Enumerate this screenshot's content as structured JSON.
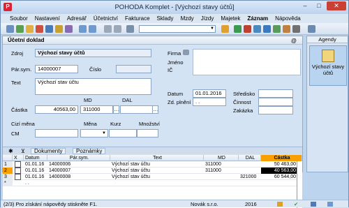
{
  "window": {
    "title": "POHODA Komplet - [Výchozí stavy účtů]",
    "app_letter": "P",
    "minimize": "–",
    "maximize": "□",
    "close": "✕"
  },
  "menu": [
    "Soubor",
    "Nastavení",
    "Adresář",
    "Účetnictví",
    "Fakturace",
    "Sklady",
    "Mzdy",
    "Jízdy",
    "Majetek",
    "Záznam",
    "Nápověda"
  ],
  "panel": {
    "title": "Účetní doklad",
    "at_symbol": "@"
  },
  "form": {
    "zdroj_label": "Zdroj",
    "zdroj_value": "Výchozí stavy účtů",
    "parsym_label": "Pár.sym.",
    "parsym_value": "14000007",
    "cislo_label": "Číslo",
    "cislo_value": "",
    "text_label": "Text",
    "text_value": "Výchozí stav účtu",
    "md_label": "MD",
    "dal_label": "DAL",
    "castka_label": "Částka",
    "castka_value": "40563,00",
    "md_value": "311000",
    "dal_value": "",
    "cizi_mena_label": "Cizí měna",
    "cm_label": "CM",
    "mena_label": "Měna",
    "kurz_label": "Kurz",
    "mnozstvi_label": "Množství",
    "firma_label": "Firma",
    "jmeno_label": "Jméno",
    "ic_label": "IČ",
    "datum_label": "Datum",
    "datum_value": "01.01.2016",
    "zd_plneni_label": "Zd. plnění",
    "zd_plneni_value": ". .",
    "stredisko_label": "Středisko",
    "cinnost_label": "Činnost",
    "zakazka_label": "Zakázka"
  },
  "tabs": {
    "dokumenty": "Dokumenty",
    "poznamky": "Poznámky"
  },
  "grid": {
    "headers": [
      "X",
      "Datum",
      "Pár.sym.",
      "Text",
      "MD",
      "DAL",
      "Částka"
    ],
    "rows": [
      {
        "num": "1",
        "datum": "01.01.16",
        "parsym": "14000006",
        "text": "Výchozí stav účtu",
        "md": "311000",
        "dal": "",
        "castka": "50 463,00"
      },
      {
        "num": "2",
        "datum": "01.01.16",
        "parsym": "14000007",
        "text": "Výchozí stav účtu",
        "md": "311000",
        "dal": "",
        "castka": "40 563,00"
      },
      {
        "num": "3",
        "datum": "01.01.16",
        "parsym": "14000008",
        "text": "Výchozí stav účtu",
        "md": "",
        "dal": "321000",
        "castka": "60 544,00"
      },
      {
        "num": "*",
        "datum": ". .",
        "parsym": "",
        "text": "",
        "md": "",
        "dal": "",
        "castka": ""
      }
    ],
    "selected_row": 1
  },
  "agenda": {
    "header": "Agendy",
    "item_label": "Výchozí stavy účtů"
  },
  "status": {
    "record": "(2/3) Pro získání nápovědy stiskněte F1.",
    "company": "Novák s.r.o.",
    "year": "2016"
  },
  "colors": {
    "accent": "#f7a000",
    "selected_row": "#f7a000",
    "titlebar": "#bcd3ee",
    "close": "#c94135"
  }
}
